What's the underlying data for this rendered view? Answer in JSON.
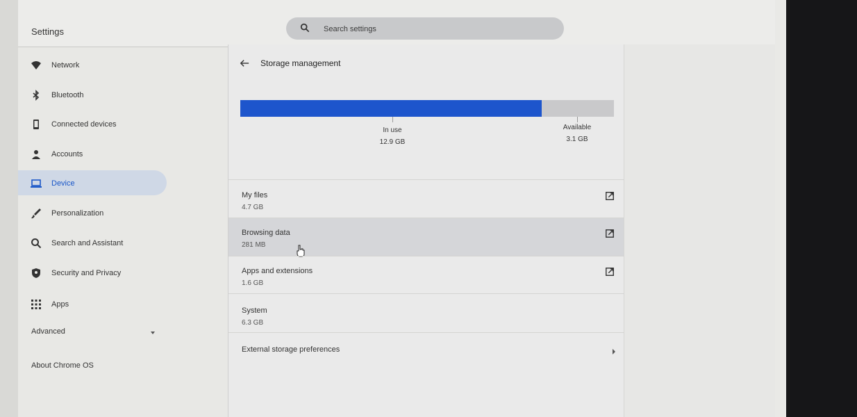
{
  "app": {
    "title": "Settings"
  },
  "search": {
    "placeholder": "Search settings"
  },
  "sidebar": {
    "items": [
      {
        "label": "Network",
        "icon": "wifi-icon"
      },
      {
        "label": "Bluetooth",
        "icon": "bluetooth-icon"
      },
      {
        "label": "Connected devices",
        "icon": "phone-icon"
      },
      {
        "label": "Accounts",
        "icon": "person-icon"
      },
      {
        "label": "Device",
        "icon": "laptop-icon",
        "selected": true
      },
      {
        "label": "Personalization",
        "icon": "brush-icon"
      },
      {
        "label": "Search and Assistant",
        "icon": "search-icon"
      },
      {
        "label": "Security and Privacy",
        "icon": "shield-icon"
      },
      {
        "label": "Apps",
        "icon": "apps-grid-icon"
      }
    ],
    "advanced": "Advanced",
    "about": "About Chrome OS"
  },
  "page": {
    "title": "Storage management",
    "usage": {
      "in_use_label": "In use",
      "in_use_value": "12.9 GB",
      "available_label": "Available",
      "available_value": "3.1 GB",
      "fraction_used": 0.806
    },
    "rows": [
      {
        "name": "My files",
        "size": "4.7 GB"
      },
      {
        "name": "Browsing data",
        "size": "281 MB"
      },
      {
        "name": "Apps and extensions",
        "size": "1.6 GB"
      },
      {
        "name": "System",
        "size": "6.3 GB"
      },
      {
        "name": "External storage preferences"
      }
    ]
  },
  "colors": {
    "accent": "#1d55cc",
    "selected_bg": "#cfd8e6",
    "hover_bg": "#d5d6d9"
  }
}
